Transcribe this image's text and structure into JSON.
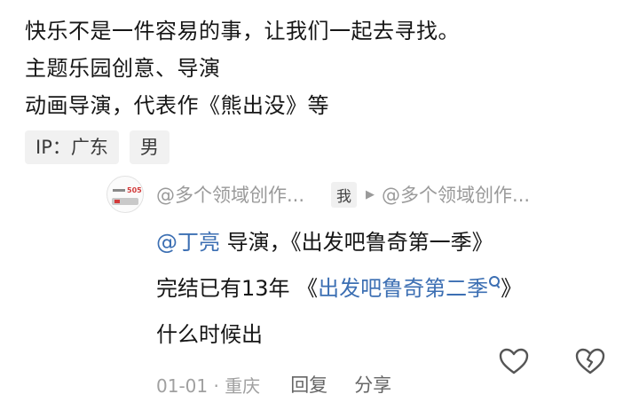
{
  "bio": {
    "lines": [
      "快乐不是一件容易的事，让我们一起去寻找。",
      "主题乐园创意、导演",
      "动画导演，代表作《熊出没》等"
    ]
  },
  "tags": {
    "ip": "IP：广东",
    "gender": "男"
  },
  "reply": {
    "author": "@多个领域创作...",
    "me_badge": "我",
    "target": "@多个领域创作...",
    "line1_mention": "@丁亮",
    "line1_rest": " 导演，《出发吧鲁奇第一季》",
    "line2_prefix": "完结已有13年 《",
    "line2_link": "出发吧鲁奇第二季",
    "line2_suffix": "》",
    "line3": "什么时候出",
    "time_location": "01-01 · 重庆",
    "reply_label": "回复",
    "share_label": "分享"
  },
  "icons": {
    "like": "heart-outline-icon",
    "dislike": "broken-heart-icon",
    "link_search": "search-icon"
  },
  "colors": {
    "link": "#3c6fb3",
    "meta": "#a0a0a0"
  }
}
